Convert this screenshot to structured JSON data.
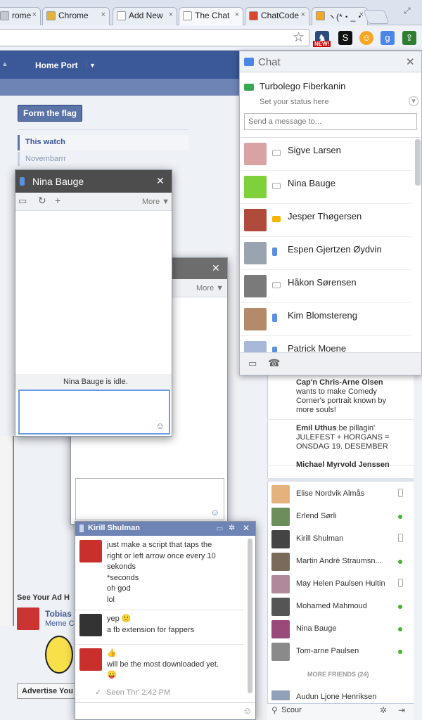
{
  "browser": {
    "tabs": [
      {
        "label": "rome",
        "color": "#c3c9d3"
      },
      {
        "label": "Chrome",
        "color": "#e3b341"
      },
      {
        "label": "Add New",
        "color": "#ffffff"
      },
      {
        "label": "The Chat",
        "color": "#ffffff"
      },
      {
        "label": "ChatCode",
        "color": "#d9452f"
      },
      {
        "label": "ヽ(*・_・",
        "color": "#f5a623"
      }
    ],
    "close_glyph": "×",
    "star_glyph": "☆",
    "new_badge": "NEW!"
  },
  "fb": {
    "nav_home": "Home Port",
    "form_flag_button": "Form the flag",
    "this_watch": "This watch",
    "novembarrr": "Novembarrr",
    "see_your_ad": "See Your Ad H",
    "ad_name": "Tobias",
    "ad_sub": "Meme C",
    "advertise": "Advertise You"
  },
  "chat_panel": {
    "title": "Chat",
    "me": "Turbolego Fiberkanin",
    "status_placeholder": "Set your status here",
    "message_placeholder": "Send a message to...",
    "friends": [
      {
        "name": "Sigve Larsen",
        "status": "chat",
        "color": "#d9a3a3"
      },
      {
        "name": "Nina Bauge",
        "status": "chat",
        "color": "#7fd13b"
      },
      {
        "name": "Jesper Thøgersen",
        "status": "video",
        "color": "#b04a3a"
      },
      {
        "name": "Espen Gjertzen Øydvin",
        "status": "mobile",
        "color": "#9aa4b0"
      },
      {
        "name": "Håkon Sørensen",
        "status": "chat",
        "color": "#7a7a7a"
      },
      {
        "name": "Kim Blomstereng",
        "status": "mobile",
        "color": "#b58a6a"
      },
      {
        "name": "Patrick Moene",
        "status": "mobile",
        "color": "#a8b8d8"
      }
    ]
  },
  "nina_window": {
    "title": "Nina Bauge",
    "more": "More ▼",
    "idle_text": "Nina Bauge is idle."
  },
  "back_window": {
    "more": "More ▼"
  },
  "kirill_window": {
    "title": "Kirill Shulman",
    "messages": [
      {
        "lines": [
          "just make a script that taps the",
          "right or left arrow once every 10",
          "sekonds",
          "*seconds",
          "oh god",
          "lol"
        ]
      },
      {
        "lines": [
          "yep 🙂",
          "a fb extension for fappers"
        ]
      },
      {
        "lines": [
          "👍",
          "will be the most downloaded yet.",
          "😛"
        ]
      }
    ],
    "seen": "Seen Thr' 2:42 PM"
  },
  "ticker": [
    {
      "bold": "Cap'n Chris-Arne Olsen",
      "text": "wants to make Comedy Corner's portrait known by more souls!"
    },
    {
      "bold": "Emil Uthus",
      "text": "be pillagin' JULEFEST + HORGANS = ONSDAG 19. DESEMBER"
    },
    {
      "bold": "Michael Myrvold Jenssen",
      "text": ""
    }
  ],
  "sidebar": {
    "friends": [
      {
        "name": "Elise Nordvik Almås",
        "status": "mobile",
        "color": "#e4b27a"
      },
      {
        "name": "Erlend Sørli",
        "status": "online",
        "color": "#6b8e5a"
      },
      {
        "name": "Kirill Shulman",
        "status": "mobile",
        "color": "#444444"
      },
      {
        "name": "Martin André Straumsn...",
        "status": "online",
        "color": "#7a6a5a"
      },
      {
        "name": "May Helen Paulsen Hultin",
        "status": "mobile",
        "color": "#b08a9a"
      },
      {
        "name": "Mohamed Mahmoud",
        "status": "online",
        "color": "#555555"
      },
      {
        "name": "Nina Bauge",
        "status": "online",
        "color": "#9a4a7a"
      },
      {
        "name": "Tom-arne Paulsen",
        "status": "online",
        "color": "#8a8a8a"
      }
    ],
    "more_friends": "MORE FRIENDS (24)",
    "more_first": "Audun Ljone Henriksen",
    "search_placeholder": "Scour"
  }
}
